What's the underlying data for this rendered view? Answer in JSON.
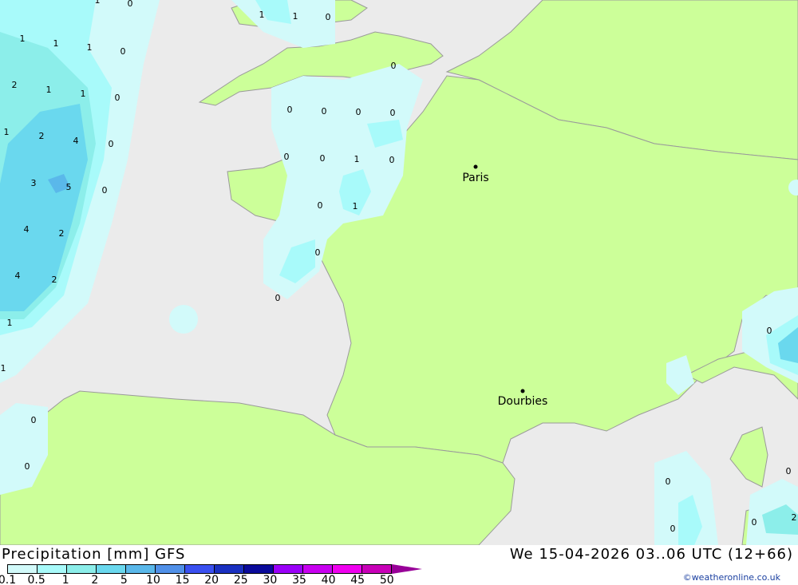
{
  "legend": {
    "title": "Precipitation [mm] GFS",
    "ticks": [
      "0.1",
      "0.5",
      "1",
      "2",
      "5",
      "10",
      "15",
      "20",
      "25",
      "30",
      "35",
      "40",
      "45",
      "50"
    ],
    "colors": [
      "#d2fafa",
      "#a8fafa",
      "#8ceeea",
      "#6ad8ee",
      "#5ab8ea",
      "#5090e8",
      "#3a50f0",
      "#1a30c0",
      "#0a0a9a",
      "#9a00f8",
      "#c800f0",
      "#f000f0",
      "#c800b8"
    ],
    "arrow_color": "#980098"
  },
  "valid_time": "We 15-04-2026 03..06 UTC (12+66)",
  "credit": "©weatheronline.co.uk",
  "cities": [
    {
      "name": "Paris"
    },
    {
      "name": "Dourbies"
    }
  ],
  "precip_labels": [
    "1",
    "0",
    "1",
    "1",
    "1",
    "0",
    "2",
    "1",
    "1",
    "0",
    "1",
    "2",
    "4",
    "0",
    "3",
    "5",
    "0",
    "4",
    "2",
    "4",
    "2",
    "1",
    "1",
    "1",
    "1",
    "0",
    "0",
    "0",
    "0",
    "0",
    "0",
    "0",
    "0",
    "1",
    "0",
    "0",
    "1",
    "0",
    "0",
    "0",
    "0",
    "0",
    "0",
    "0",
    "0",
    "0",
    "2"
  ],
  "colors": {
    "land": "#ccff99",
    "sea": "#ebebeb",
    "border": "#9a9a9a"
  }
}
